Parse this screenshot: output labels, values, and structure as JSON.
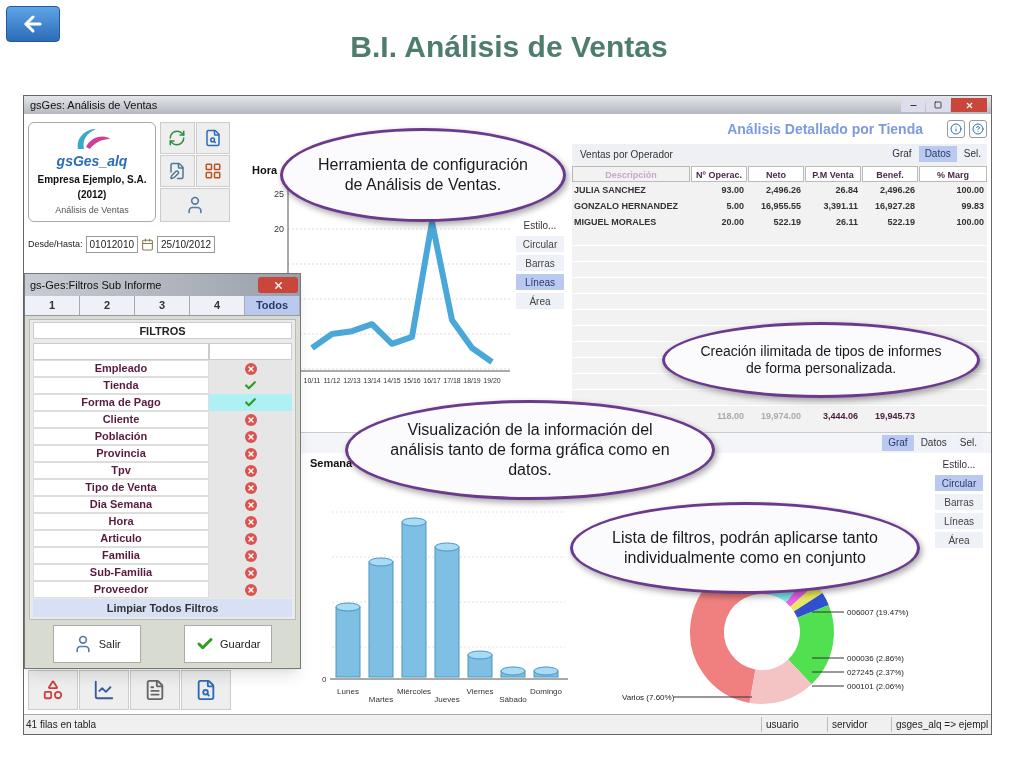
{
  "slide": {
    "title": "B.I. Análisis de Ventas"
  },
  "window": {
    "title": "gsGes: Análisis de Ventas"
  },
  "company": {
    "app_name": "gsGes_alq",
    "name": "Empresa Ejemplo, S.A.",
    "year": "(2012)",
    "module": "Análisis de Ventas"
  },
  "date_range": {
    "label": "Desde/Hasta:",
    "from": "01012010",
    "to": "25/10/2012"
  },
  "top_report": {
    "title": "Análisis Detallado por Tienda"
  },
  "hour_chart": {
    "label": "Hora",
    "y_ticks": [
      "25",
      "20"
    ],
    "x_labels": [
      "10/11",
      "11/12",
      "12/13",
      "13/14",
      "14/15",
      "15/16",
      "16/17",
      "17/18",
      "18/19",
      "19/20"
    ]
  },
  "top_styles": {
    "label": "Estilo...",
    "options": [
      {
        "label": "Circular",
        "selected": false
      },
      {
        "label": "Barras",
        "selected": false
      },
      {
        "label": "Líneas",
        "selected": true
      },
      {
        "label": "Área",
        "selected": false
      }
    ]
  },
  "operator_table": {
    "title": "Ventas por Operador",
    "views": [
      {
        "label": "Graf",
        "selected": false
      },
      {
        "label": "Datos",
        "selected": true
      },
      {
        "label": "Sel.",
        "selected": false
      }
    ],
    "columns": [
      "Descripción",
      "Nº Operac.",
      "Neto",
      "P.M Venta",
      "Benef.",
      "% Marg"
    ],
    "rows": [
      [
        "JULIA SANCHEZ",
        "93.00",
        "2,496.26",
        "26.84",
        "2,496.26",
        "100.00"
      ],
      [
        "GONZALO HERNANDEZ",
        "5.00",
        "16,955.55",
        "3,391.11",
        "16,927.28",
        "99.83"
      ],
      [
        "MIGUEL MORALES",
        "20.00",
        "522.19",
        "26.11",
        "522.19",
        "100.00"
      ]
    ],
    "totals": [
      "118.00",
      "19,974.00",
      "3,444.06",
      "19,945.73"
    ]
  },
  "week_chart": {
    "label": "Semana",
    "y_tick": "0",
    "days": [
      "Lunes",
      "Martes",
      "Miércoles",
      "Jueves",
      "Viernes",
      "Sábado",
      "Domingo"
    ]
  },
  "bottom_panel": {
    "views": [
      {
        "label": "Graf",
        "selected": true
      },
      {
        "label": "Datos",
        "selected": false
      },
      {
        "label": "Sel.",
        "selected": false
      }
    ],
    "styles": {
      "label": "Estilo...",
      "options": [
        {
          "label": "Circular",
          "selected": true
        },
        {
          "label": "Barras",
          "selected": false
        },
        {
          "label": "Líneas",
          "selected": false
        },
        {
          "label": "Área",
          "selected": false
        }
      ]
    },
    "donut_labels": [
      "006007 (19.47%)",
      "000036 (2.86%)",
      "027245 (2.37%)",
      "000101 (2.06%)",
      "Varios (7.60%)"
    ]
  },
  "filters_window": {
    "title": "gs-Ges:Filtros Sub Informe",
    "tabs": [
      {
        "label": "1",
        "selected": false
      },
      {
        "label": "2",
        "selected": false
      },
      {
        "label": "3",
        "selected": false
      },
      {
        "label": "4",
        "selected": false
      },
      {
        "label": "Todos",
        "selected": true
      }
    ],
    "header": "FILTROS",
    "filters": [
      {
        "name": "Empleado",
        "active": false,
        "selected": false
      },
      {
        "name": "Tienda",
        "active": true,
        "selected": false
      },
      {
        "name": "Forma de Pago",
        "active": true,
        "selected": true
      },
      {
        "name": "Cliente",
        "active": false,
        "selected": false
      },
      {
        "name": "Población",
        "active": false,
        "selected": false
      },
      {
        "name": "Provincia",
        "active": false,
        "selected": false
      },
      {
        "name": "Tpv",
        "active": false,
        "selected": false
      },
      {
        "name": "Tipo de Venta",
        "active": false,
        "selected": false
      },
      {
        "name": "Dia Semana",
        "active": false,
        "selected": false
      },
      {
        "name": "Hora",
        "active": false,
        "selected": false
      },
      {
        "name": "Articulo",
        "active": false,
        "selected": false
      },
      {
        "name": "Familia",
        "active": false,
        "selected": false
      },
      {
        "name": "Sub-Familia",
        "active": false,
        "selected": false
      },
      {
        "name": "Proveedor",
        "active": false,
        "selected": false
      }
    ],
    "clear_button": "Limpiar Todos Filtros",
    "buttons": [
      {
        "label": "Salir",
        "kind": "exit"
      },
      {
        "label": "Guardar",
        "kind": "save"
      }
    ]
  },
  "status_bar": {
    "rows": "41 filas en tabla",
    "user": "usuario",
    "server": "servidor",
    "connection": "gsges_alq => ejempl"
  },
  "callouts": [
    {
      "text": "Herramienta de configuración de Análisis de Ventas."
    },
    {
      "text": "Creación ilimitada de tipos de informes de forma personalizada."
    },
    {
      "text": "Visualización de la información del análisis tanto de forma gráfica como en datos."
    },
    {
      "text": "Lista de filtros, podrán aplicarse tanto individualmente como en conjunto"
    }
  ]
}
